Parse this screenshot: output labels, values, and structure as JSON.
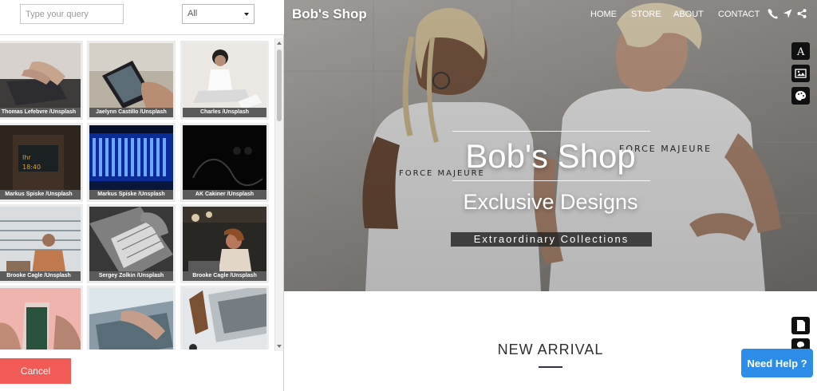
{
  "picker": {
    "search_placeholder": "Type your query",
    "filter_value": "All",
    "credits": [
      "Thomas Lefebvre /Unsplash",
      "Jaelynn Castillo /Unsplash",
      "Charles /Unsplash",
      "Markus Spiske /Unsplash",
      "Markus Spiske /Unsplash",
      "AK Cakiner /Unsplash",
      "Brooke Cagle /Unsplash",
      "Sergey Zolkin /Unsplash",
      "Brooke Cagle /Unsplash"
    ],
    "cancel_label": "Cancel"
  },
  "site": {
    "brand": "Bob's Shop",
    "nav": [
      "HOME",
      "STORE",
      "ABOUT",
      "CONTACT"
    ],
    "hero_title": "Bob's Shop",
    "hero_subtitle": "Exclusive Designs",
    "hero_tagline": "Extraordinary Collections",
    "section_title": "NEW ARRIVAL",
    "help_label": "Need Help ?"
  },
  "colors": {
    "cancel_bg": "#f25a55",
    "help_bg": "#2d8ce8",
    "hero_overlay": "#808080"
  },
  "icons": {
    "nav": [
      "phone-icon",
      "location-arrow-icon",
      "share-icon"
    ],
    "tools": [
      "font-icon",
      "image-icon",
      "palette-icon",
      "document-icon"
    ]
  }
}
